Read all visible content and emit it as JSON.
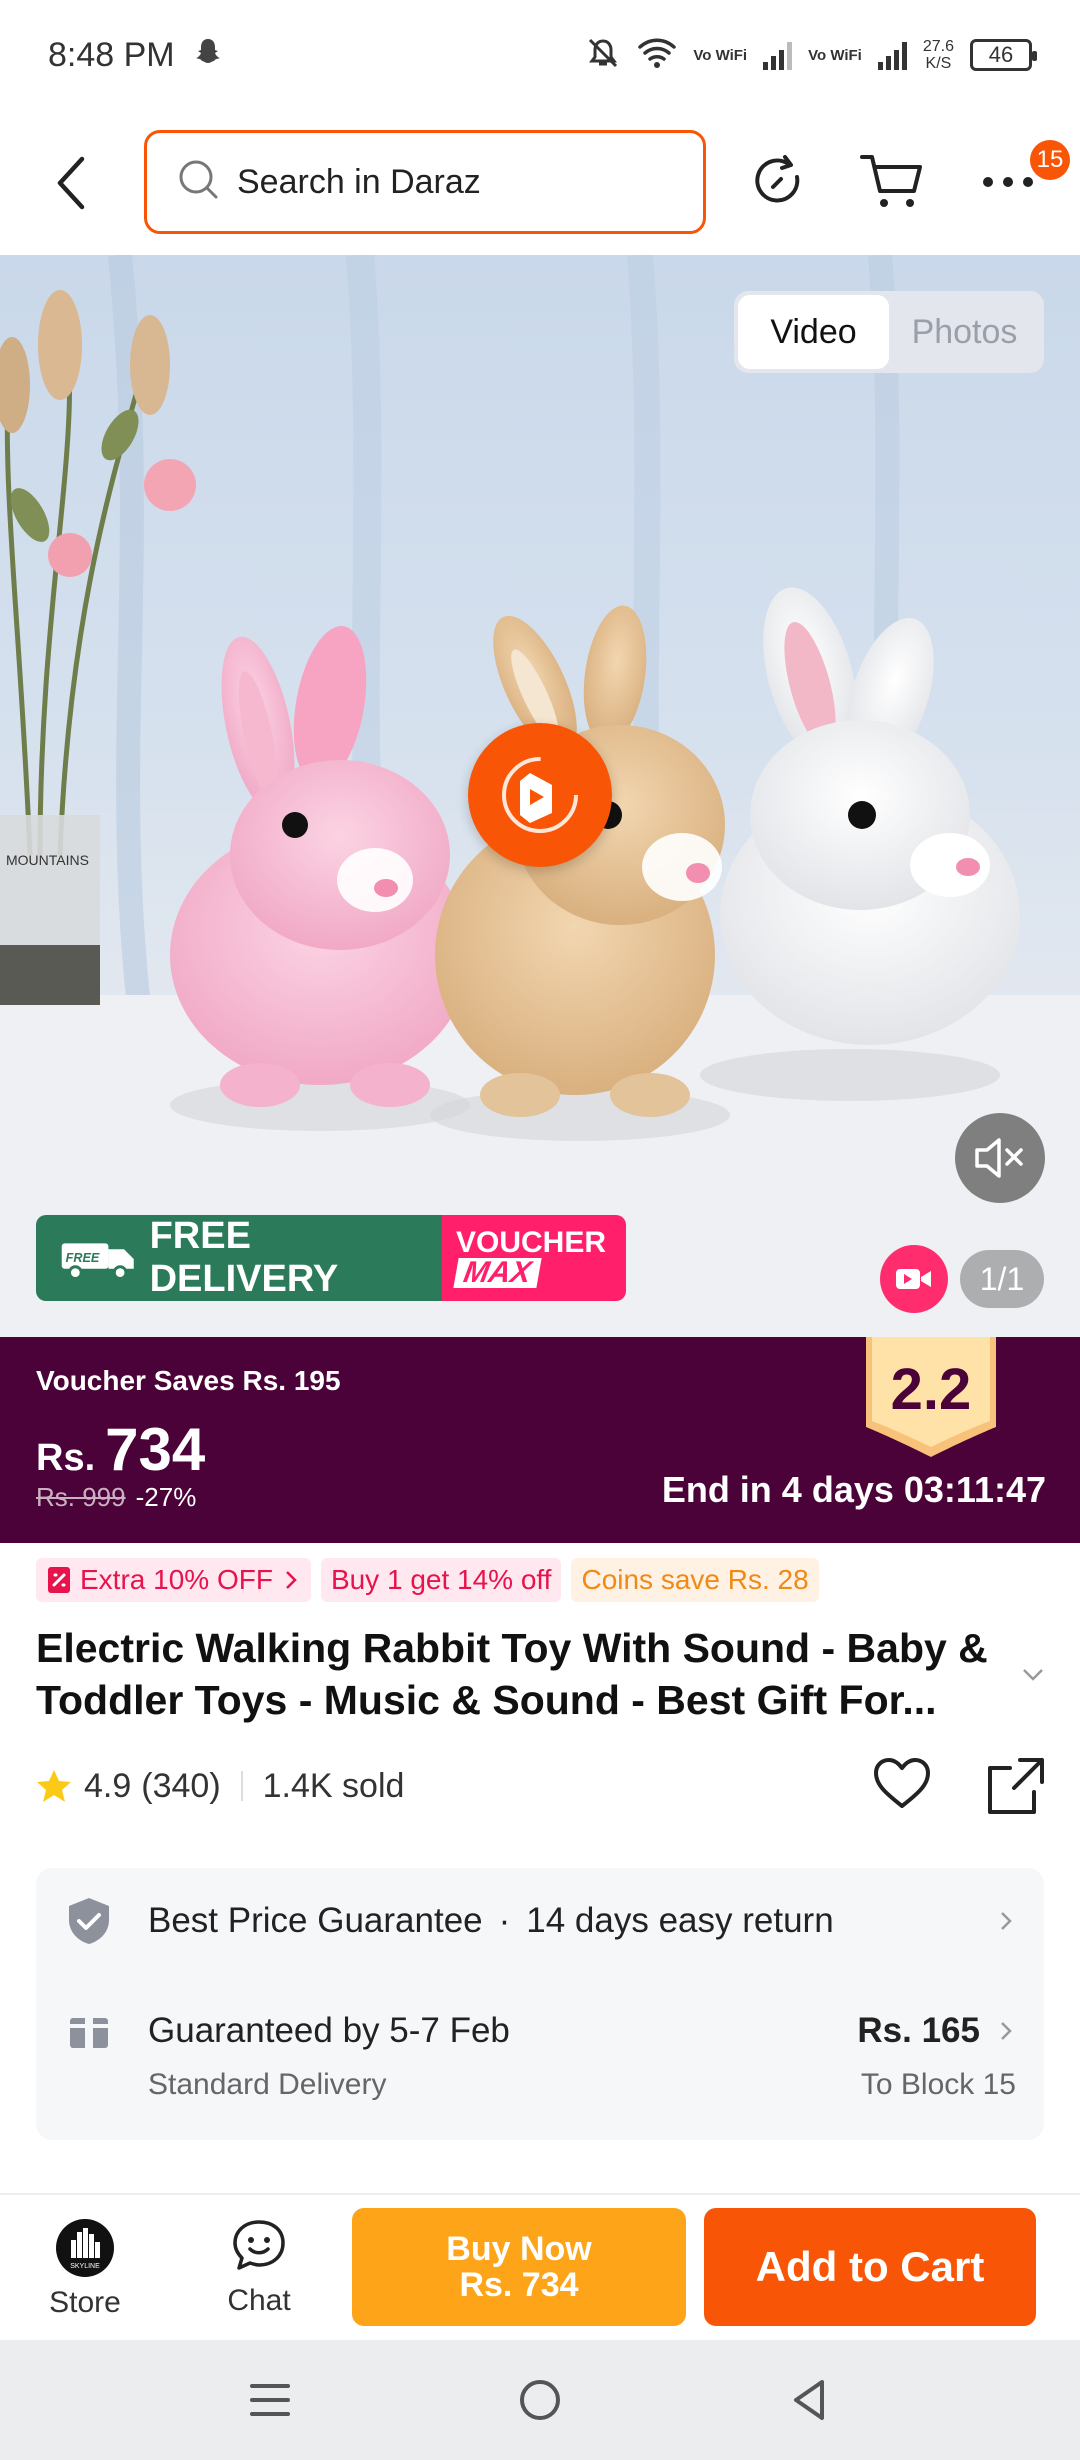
{
  "status_bar": {
    "time": "8:48 PM",
    "vowifi1": "Vo WiFi",
    "vowifi2": "Vo WiFi",
    "net_speed": "27.6",
    "net_unit": "K/S",
    "battery": "46"
  },
  "header": {
    "search_placeholder": "Search in Daraz",
    "cart_badge": "15"
  },
  "media": {
    "tabs": [
      {
        "label": "Video",
        "active": true
      },
      {
        "label": "Photos",
        "active": false
      }
    ],
    "banner_free_delivery": "FREE DELIVERY",
    "banner_free_tag": "FREE",
    "banner_voucher": "VOUCHER",
    "banner_max": "MAX",
    "counter": "1/1",
    "vase_label": "MOUNTAINS"
  },
  "price": {
    "voucher_saves": "Voucher Saves Rs. 195",
    "currency": "Rs.",
    "amount": "734",
    "original": "Rs. 999",
    "discount": "-27%",
    "end_text": "End in 4 days 03:11:47",
    "sale_badge": "2.2"
  },
  "tags": [
    "Extra 10% OFF",
    "Buy 1 get 14% off",
    "Coins save Rs. 28"
  ],
  "product": {
    "title": "Electric Walking Rabbit Toy With Sound  - Baby & Toddler Toys - Music & Sound - Best Gift For...",
    "rating": "4.9",
    "reviews": "(340)",
    "sold": "1.4K sold"
  },
  "info": {
    "guarantee": "Best Price Guarantee",
    "return_policy": "14 days easy return",
    "delivery_title": "Guaranteed by 5-7 Feb",
    "delivery_type": "Standard Delivery",
    "delivery_price": "Rs. 165",
    "delivery_location": "To Block 15"
  },
  "actions": {
    "store": "Store",
    "store_logo": "SKYLINE",
    "chat": "Chat",
    "buy_now": "Buy Now",
    "buy_now_price": "Rs. 734",
    "add_to_cart": "Add to Cart"
  },
  "colors": {
    "brand": "#f85606",
    "price_band": "#4b0238",
    "buy_now": "#fea419",
    "free_delivery": "#2b7b5a",
    "voucher": "#ff1f6a"
  }
}
